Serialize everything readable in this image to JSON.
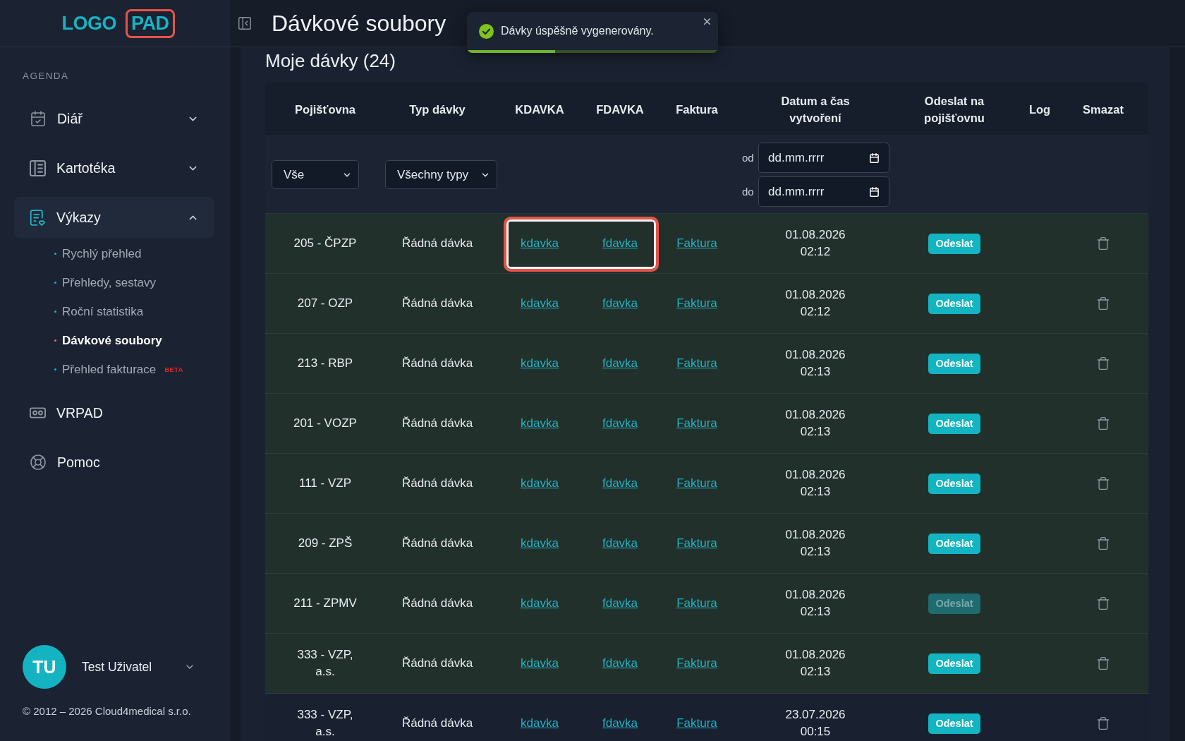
{
  "sidebar": {
    "logo": [
      {
        "text": "LOGO",
        "highlighted": false
      },
      {
        "text": "PAD",
        "highlighted": true
      }
    ],
    "section_label": "AGENDA",
    "nav": [
      {
        "label": "Diář",
        "kind": "group",
        "expanded": false,
        "selected": false
      },
      {
        "label": "Kartotéka",
        "kind": "group",
        "expanded": false,
        "selected": false
      },
      {
        "label": "Výkazy",
        "kind": "group",
        "expanded": true,
        "selected": true,
        "children": [
          {
            "label": "Rychlý přehled",
            "selected": false
          },
          {
            "label": "Přehledy, sestavy",
            "selected": false
          },
          {
            "label": "Roční statistika",
            "selected": false
          },
          {
            "label": "Dávkové soubory",
            "selected": true
          },
          {
            "label": "Přehled fakturace",
            "selected": false,
            "badge": "BETA"
          }
        ]
      },
      {
        "label": "VRPAD",
        "kind": "link",
        "expanded": false,
        "selected": false
      },
      {
        "label": "Pomoc",
        "kind": "link",
        "expanded": false,
        "selected": false
      }
    ],
    "user": {
      "initials": "TU",
      "name": "Test Uživatel"
    },
    "copyright": "© 2012 – 2026 Cloud4medical s.r.o."
  },
  "header": {
    "title": "Dávkové soubory"
  },
  "toast": {
    "message": "Dávky úspěšně vygenerovány.",
    "level": 0.35
  },
  "panel": {
    "title": "Moje dávky (24)"
  },
  "table": {
    "columns": [
      "Pojišťovna",
      "Typ dávky",
      "KDAVKA",
      "FDAVKA",
      "Faktura",
      "Datum a čas vytvoření",
      "Odeslat na pojišťovnu",
      "Log",
      "Smazat"
    ],
    "filters": {
      "insurer": {
        "value": "Vše"
      },
      "type": {
        "value": "Všechny typy"
      },
      "date_from": {
        "label": "od",
        "placeholder": "dd.mm.rrrr"
      },
      "date_to": {
        "label": "do",
        "placeholder": "dd.mm.rrrr"
      }
    },
    "rows": [
      {
        "insurer": "205 - ČPZP",
        "type": "Řádná dávka",
        "kdavka": "kdavka",
        "fdavka": "fdavka",
        "invoice": "Faktura",
        "created": "01.08.2026 02:12",
        "send": "Odeslat",
        "disabled": false,
        "recent": true,
        "highlighted": true
      },
      {
        "insurer": "207 - OZP",
        "type": "Řádná dávka",
        "kdavka": "kdavka",
        "fdavka": "fdavka",
        "invoice": "Faktura",
        "created": "01.08.2026 02:12",
        "send": "Odeslat",
        "disabled": false,
        "recent": true,
        "highlighted": false
      },
      {
        "insurer": "213 - RBP",
        "type": "Řádná dávka",
        "kdavka": "kdavka",
        "fdavka": "fdavka",
        "invoice": "Faktura",
        "created": "01.08.2026 02:13",
        "send": "Odeslat",
        "disabled": false,
        "recent": true,
        "highlighted": false
      },
      {
        "insurer": "201 - VOZP",
        "type": "Řádná dávka",
        "kdavka": "kdavka",
        "fdavka": "fdavka",
        "invoice": "Faktura",
        "created": "01.08.2026 02:13",
        "send": "Odeslat",
        "disabled": false,
        "recent": true,
        "highlighted": false
      },
      {
        "insurer": "111 - VZP",
        "type": "Řádná dávka",
        "kdavka": "kdavka",
        "fdavka": "fdavka",
        "invoice": "Faktura",
        "created": "01.08.2026 02:13",
        "send": "Odeslat",
        "disabled": false,
        "recent": true,
        "highlighted": false
      },
      {
        "insurer": "209 - ZPŠ",
        "type": "Řádná dávka",
        "kdavka": "kdavka",
        "fdavka": "fdavka",
        "invoice": "Faktura",
        "created": "01.08.2026 02:13",
        "send": "Odeslat",
        "disabled": false,
        "recent": true,
        "highlighted": false
      },
      {
        "insurer": "211 - ZPMV",
        "type": "Řádná dávka",
        "kdavka": "kdavka",
        "fdavka": "fdavka",
        "invoice": "Faktura",
        "created": "01.08.2026 02:13",
        "send": "Odeslat",
        "disabled": true,
        "recent": true,
        "highlighted": false
      },
      {
        "insurer": "333 - VZP, a.s.",
        "type": "Řádná dávka",
        "kdavka": "kdavka",
        "fdavka": "fdavka",
        "invoice": "Faktura",
        "created": "01.08.2026 02:13",
        "send": "Odeslat",
        "disabled": false,
        "recent": true,
        "highlighted": false
      },
      {
        "insurer": "333 - VZP, a.s.",
        "type": "Řádná dávka",
        "kdavka": "kdavka",
        "fdavka": "fdavka",
        "invoice": "Faktura",
        "created": "23.07.2026 00:15",
        "send": "Odeslat",
        "disabled": false,
        "recent": false,
        "highlighted": false
      }
    ]
  }
}
